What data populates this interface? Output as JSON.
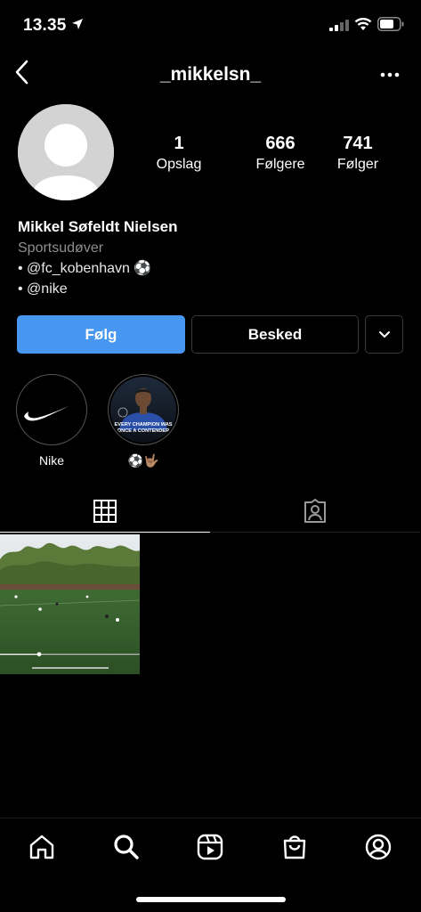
{
  "status_bar": {
    "time": "13.35"
  },
  "header": {
    "username": "_mikkelsn_"
  },
  "stats": [
    {
      "value": "1",
      "label": "Opslag"
    },
    {
      "value": "666",
      "label": "Følgere"
    },
    {
      "value": "741",
      "label": "Følger"
    }
  ],
  "bio": {
    "name": "Mikkel Søfeldt Nielsen",
    "category": "Sportsudøver",
    "lines": [
      "• @fc_kobenhavn ⚽",
      "• @nike"
    ]
  },
  "buttons": {
    "follow": "Følg",
    "message": "Besked"
  },
  "highlights": [
    {
      "label": "Nike"
    },
    {
      "label": "⚽🤟🏽"
    }
  ],
  "highlight_texts": {
    "line1": "EVERY CHAMPION WAS",
    "line2": "ONCE A CONTENDER"
  },
  "colors": {
    "follow_button": "#4796f0",
    "background": "#000000",
    "secondary_text": "#8e8e8e"
  },
  "icons": {
    "back": "chevron-left-icon",
    "more": "more-horizontal-icon",
    "grid_tab": "grid-icon",
    "tagged_tab": "tagged-person-icon",
    "nav": [
      "home-icon",
      "search-icon",
      "reels-icon",
      "shop-icon",
      "profile-icon"
    ]
  }
}
